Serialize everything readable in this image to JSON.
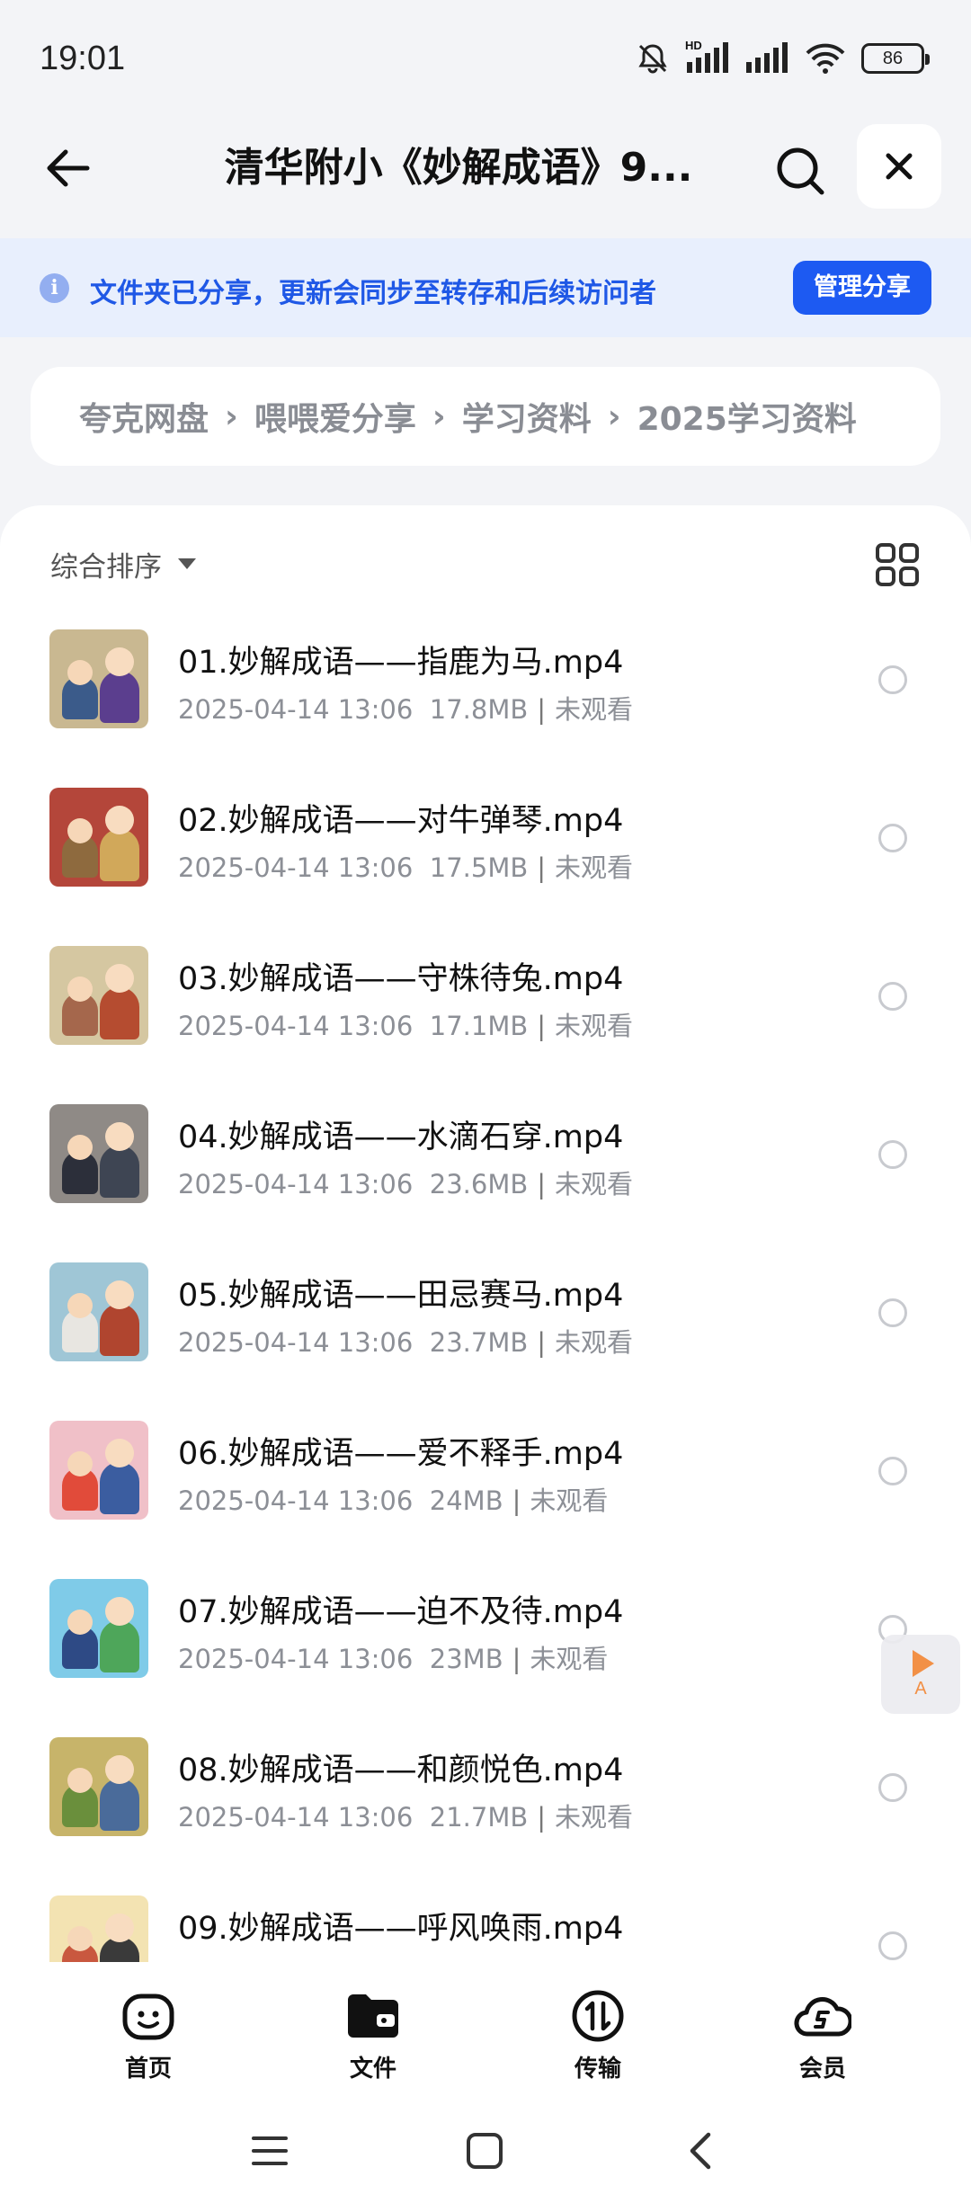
{
  "status_bar": {
    "time": "19:01",
    "network_label": "HD",
    "battery": "86"
  },
  "header": {
    "title": "清华附小《妙解成语》9..."
  },
  "share_banner": {
    "text": "文件夹已分享，更新会同步至转存和后续访问者",
    "manage_label": "管理分享"
  },
  "breadcrumb": [
    "夸克网盘",
    "喂喂爱分享",
    "学习资料",
    "2025学习资料"
  ],
  "sort": {
    "label": "综合排序"
  },
  "files": [
    {
      "name": "01.妙解成语——指鹿为马.mp4",
      "date": "2025-04-14 13:06",
      "size": "17.8MB",
      "status": "未观看",
      "thumb_bg": "#c9b891",
      "fig_a": "#3b5b8a",
      "fig_b": "#5b3e8e"
    },
    {
      "name": "02.妙解成语——对牛弹琴.mp4",
      "date": "2025-04-14 13:06",
      "size": "17.5MB",
      "status": "未观看",
      "thumb_bg": "#b4463a",
      "fig_a": "#8e6a3e",
      "fig_b": "#d1a85a"
    },
    {
      "name": "03.妙解成语——守株待兔.mp4",
      "date": "2025-04-14 13:06",
      "size": "17.1MB",
      "status": "未观看",
      "thumb_bg": "#d5c7a1",
      "fig_a": "#a5674c",
      "fig_b": "#b54c30"
    },
    {
      "name": "04.妙解成语——水滴石穿.mp4",
      "date": "2025-04-14 13:06",
      "size": "23.6MB",
      "status": "未观看",
      "thumb_bg": "#8f8a86",
      "fig_a": "#2c2f3a",
      "fig_b": "#3e4553"
    },
    {
      "name": "05.妙解成语——田忌赛马.mp4",
      "date": "2025-04-14 13:06",
      "size": "23.7MB",
      "status": "未观看",
      "thumb_bg": "#9fc6d6",
      "fig_a": "#e8e6e1",
      "fig_b": "#b0452f"
    },
    {
      "name": "06.妙解成语——爱不释手.mp4",
      "date": "2025-04-14 13:06",
      "size": "24MB",
      "status": "未观看",
      "thumb_bg": "#f0c0c8",
      "fig_a": "#e14b3a",
      "fig_b": "#3b5da0"
    },
    {
      "name": "07.妙解成语——迫不及待.mp4",
      "date": "2025-04-14 13:06",
      "size": "23MB",
      "status": "未观看",
      "thumb_bg": "#7fcbe8",
      "fig_a": "#2e4a85",
      "fig_b": "#4ea65a"
    },
    {
      "name": "08.妙解成语——和颜悦色.mp4",
      "date": "2025-04-14 13:06",
      "size": "21.7MB",
      "status": "未观看",
      "thumb_bg": "#c7b46a",
      "fig_a": "#6a8f3c",
      "fig_b": "#4a6b9a"
    },
    {
      "name": "09.妙解成语——呼风唤雨.mp4",
      "date": "",
      "size": "",
      "status": "",
      "thumb_bg": "#f3e3b2",
      "fig_a": "#c9583f",
      "fig_b": "#3a3a3a"
    }
  ],
  "float_widget": {
    "label": "A"
  },
  "bottom_nav": [
    {
      "label": "首页",
      "icon": "home-face-icon"
    },
    {
      "label": "文件",
      "icon": "folder-icon"
    },
    {
      "label": "传输",
      "icon": "transfer-icon"
    },
    {
      "label": "会员",
      "icon": "vip-cloud-icon"
    }
  ],
  "colors": {
    "accent": "#1d5af2",
    "banner_bg": "#e8effd",
    "banner_text": "#1f58e6",
    "muted": "#8c8f96"
  }
}
